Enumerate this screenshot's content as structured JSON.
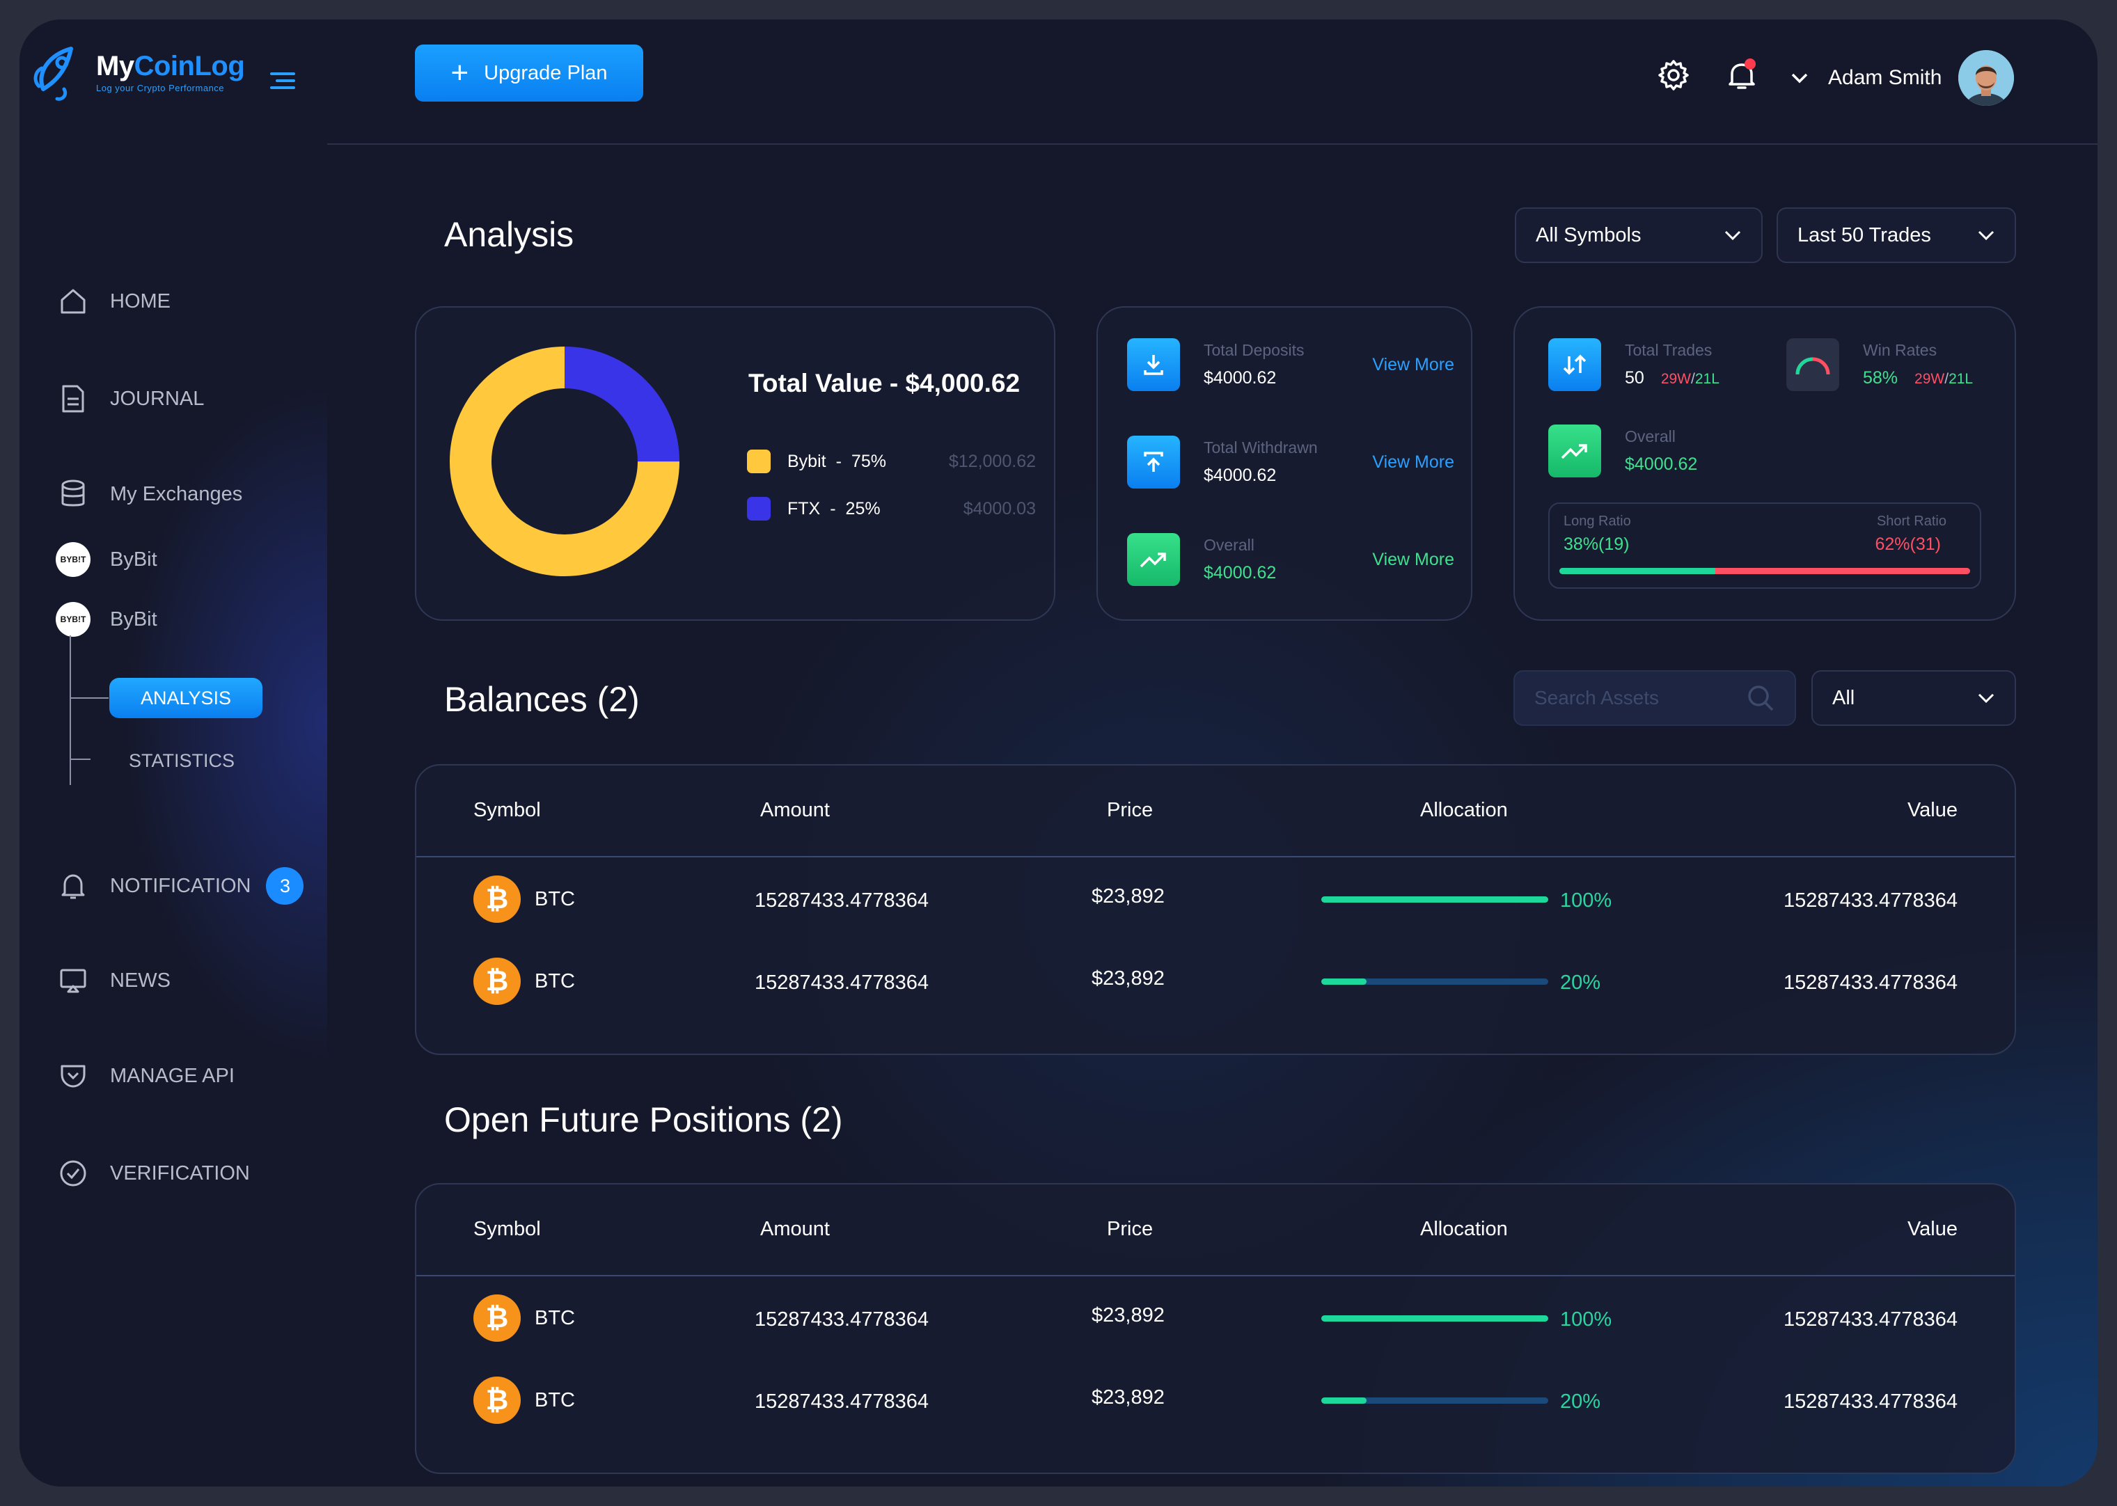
{
  "app": {
    "name_a": "My",
    "name_b": "CoinLog",
    "tagline": "Log your Crypto Performance"
  },
  "topbar": {
    "upgrade_label": "Upgrade Plan",
    "user_name": "Adam Smith"
  },
  "sidebar": {
    "home": "HOME",
    "journal": "JOURNAL",
    "exchanges": "My Exchanges",
    "exchange_1": "ByBit",
    "exchange_2": "ByBit",
    "exchange_logo_text": "BYB!T",
    "analysis": "ANALYSIS",
    "statistics": "STATISTICS",
    "notification": "NOTIFICATION",
    "notification_count": "3",
    "news": "NEWS",
    "manage_api": "MANAGE API",
    "verification": "VERIFICATION"
  },
  "analysis": {
    "title": "Analysis",
    "symbol_filter": "All Symbols",
    "trade_filter": "Last 50 Trades",
    "total_value": "Total Value - $4,000.62",
    "legend": [
      {
        "name": "Bybit",
        "pct": "75%",
        "amount": "$12,000.62",
        "color": "#ffc83d"
      },
      {
        "name": "FTX",
        "pct": "25%",
        "amount": "$4000.03",
        "color": "#3a34e8"
      }
    ],
    "donut": {
      "bybit_share": 0.75,
      "ftx_share": 0.25
    },
    "deposits_label": "Total Deposits",
    "deposits_value": "$4000.62",
    "withdrawn_label": "Total Withdrawn",
    "withdrawn_value": "$4000.62",
    "overall_label": "Overall",
    "overall_value": "$4000.62",
    "view_more": "View More",
    "total_trades_label": "Total Trades",
    "total_trades_value": "50",
    "trades_w": "29W",
    "trades_l": "21L",
    "win_rates_label": "Win Rates",
    "win_rates_value": "58%",
    "win_w": "29W",
    "win_l": "21L",
    "overall2_label": "Overall",
    "overall2_value": "$4000.62",
    "long_ratio_label": "Long Ratio",
    "long_ratio_value": "38%(19)",
    "short_ratio_label": "Short Ratio",
    "short_ratio_value": "62%(31)",
    "long_share": 0.38
  },
  "balances": {
    "title": "Balances (2)",
    "search_placeholder": "Search Assets",
    "filter": "All",
    "columns": [
      "Symbol",
      "Amount",
      "Price",
      "Allocation",
      "Value"
    ],
    "rows": [
      {
        "symbol": "BTC",
        "amount": "15287433.4778364",
        "price": "$23,892",
        "allocation": "100%",
        "alloc_share": 1.0,
        "value": "15287433.4778364"
      },
      {
        "symbol": "BTC",
        "amount": "15287433.4778364",
        "price": "$23,892",
        "allocation": "20%",
        "alloc_share": 0.2,
        "value": "15287433.4778364"
      }
    ]
  },
  "positions": {
    "title": "Open Future Positions (2)",
    "columns": [
      "Symbol",
      "Amount",
      "Price",
      "Allocation",
      "Value"
    ],
    "rows": [
      {
        "symbol": "BTC",
        "amount": "15287433.4778364",
        "price": "$23,892",
        "allocation": "100%",
        "alloc_share": 1.0,
        "value": "15287433.4778364"
      },
      {
        "symbol": "BTC",
        "amount": "15287433.4778364",
        "price": "$23,892",
        "allocation": "20%",
        "alloc_share": 0.2,
        "value": "15287433.4778364"
      }
    ]
  },
  "colors": {
    "accent": "#1a8cff",
    "positive": "#3fe18f",
    "negative": "#ff4f63",
    "bybit": "#ffc83d",
    "ftx": "#3a34e8",
    "btc": "#f7931a"
  }
}
